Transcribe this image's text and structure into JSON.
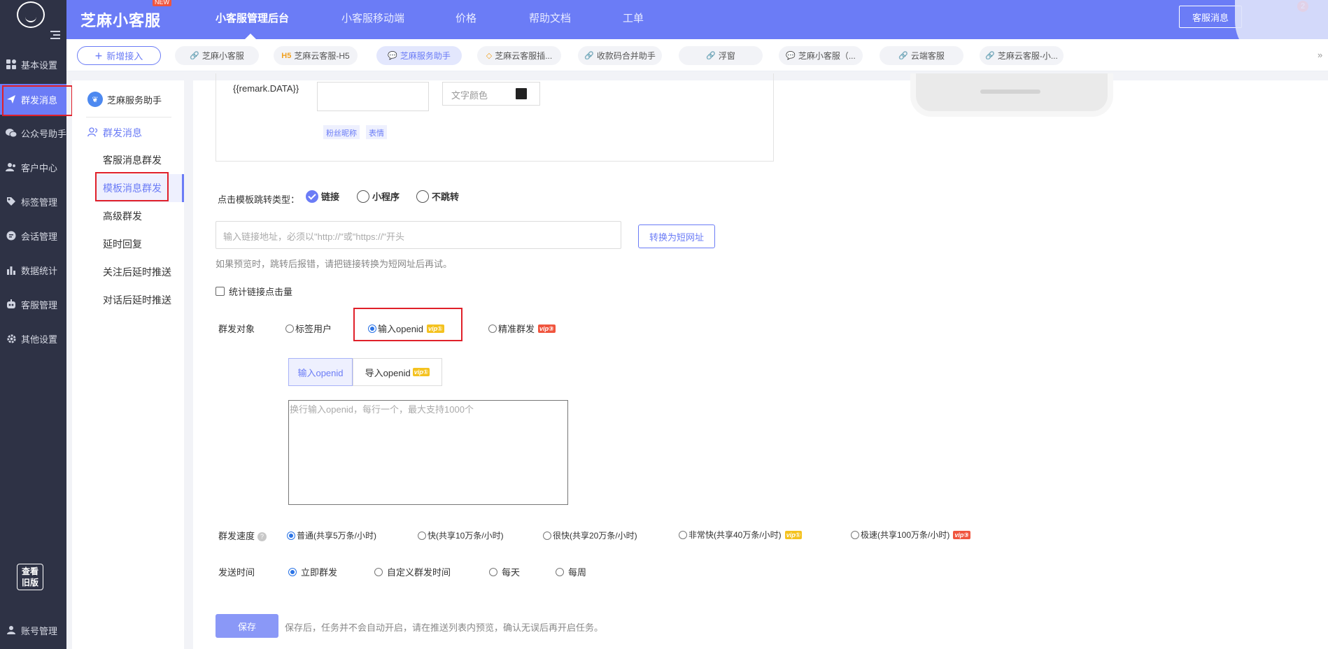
{
  "sidebar": {
    "items": [
      {
        "label": "基本设置",
        "icon": "grid-icon"
      },
      {
        "label": "群发消息",
        "icon": "send-icon"
      },
      {
        "label": "公众号助手",
        "icon": "wechat-icon"
      },
      {
        "label": "客户中心",
        "icon": "users-icon"
      },
      {
        "label": "标签管理",
        "icon": "tag-icon"
      },
      {
        "label": "会话管理",
        "icon": "chat-icon"
      },
      {
        "label": "数据统计",
        "icon": "bar-chart-icon"
      },
      {
        "label": "客服管理",
        "icon": "robot-icon"
      },
      {
        "label": "其他设置",
        "icon": "gear-icon"
      }
    ],
    "old_version": "查看旧版",
    "old_version_line1": "查看",
    "old_version_line2": "旧版",
    "account": "账号管理"
  },
  "header": {
    "brand": "芝麻小客服",
    "new_badge": "NEW",
    "nav": [
      "小客服管理后台",
      "小客服移动端",
      "价格",
      "帮助文档",
      "工单"
    ],
    "kefu_button": "客服消息",
    "kefu_count": "2"
  },
  "tabs": {
    "add_label": "新增接入",
    "channels": [
      {
        "label": "芝麻小客服",
        "prefix": "🔗"
      },
      {
        "label": "芝麻云客服-H5",
        "prefix": "H5"
      },
      {
        "label": "芝麻服务助手",
        "prefix": "💬"
      },
      {
        "label": "芝麻云客服插...",
        "prefix": "◇"
      },
      {
        "label": "收款码合并助手",
        "prefix": "🔗"
      },
      {
        "label": "浮窗",
        "prefix": "🔗"
      },
      {
        "label": "芝麻小客服（...",
        "prefix": "💬"
      },
      {
        "label": "云端客服",
        "prefix": "🔗"
      },
      {
        "label": "芝麻云客服-小...",
        "prefix": "🔗"
      }
    ]
  },
  "subnav": {
    "account_name": "芝麻服务助手",
    "group_label": "群发消息",
    "items": [
      "客服消息群发",
      "模板消息群发",
      "高级群发",
      "延时回复",
      "关注后延时推送",
      "对话后延时推送"
    ]
  },
  "form": {
    "remark_label": "{{remark.DATA}}",
    "color_label": "文字颜色",
    "color_value": "#222222",
    "tag_fans_nickname": "粉丝昵称",
    "tag_emoji": "表情",
    "jump_type_label": "点击模板跳转类型：",
    "jump_options": [
      "链接",
      "小程序",
      "不跳转"
    ],
    "url_placeholder": "输入链接地址，必须以\"http://\"或\"https://\"开头",
    "short_url_button": "转换为短网址",
    "url_hint": "如果预览时，跳转后报错，请把链接转换为短网址后再试。",
    "stat_click_label": "统计链接点击量",
    "target_label": "群发对象",
    "target_options": [
      "标签用户",
      "输入openid",
      "精准群发"
    ],
    "vip1": "vip①",
    "vip3": "vip③",
    "seg_input_openid": "输入openid",
    "seg_import_openid": "导入openid",
    "openid_placeholder": "换行输入openid，每行一个，最大支持1000个",
    "speed_label": "群发速度",
    "speed_options": [
      "普通(共享5万条/小时)",
      "快(共享10万条/小时)",
      "很快(共享20万条/小时)",
      "非常快(共享40万条/小时)",
      "极速(共享100万条/小时)"
    ],
    "send_time_label": "发送时间",
    "send_time_options": [
      "立即群发",
      "自定义群发时间",
      "每天",
      "每周"
    ],
    "save_button": "保存",
    "save_hint": "保存后，任务并不会自动开启，请在推送列表内预览，确认无误后再开启任务。"
  }
}
